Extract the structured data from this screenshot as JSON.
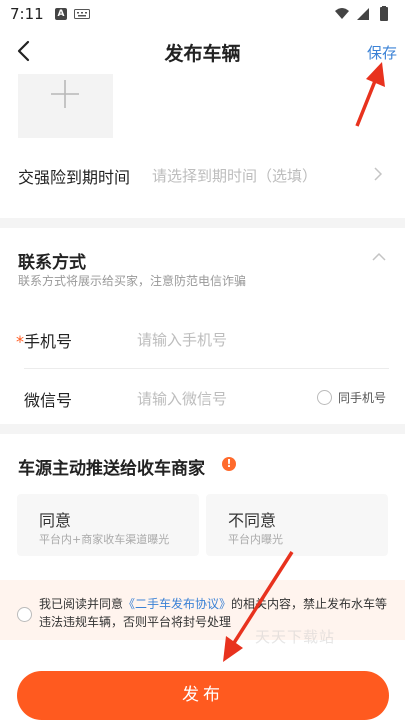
{
  "status_bar": {
    "time": "7:11",
    "notif_icon": "A"
  },
  "nav": {
    "title": "发布车辆",
    "save_label": "保存"
  },
  "insurance": {
    "label": "交强险到期时间",
    "placeholder": "请选择到期时间（选填）"
  },
  "contact": {
    "title": "联系方式",
    "subtitle": "联系方式将展示给买家，注意防范电信诈骗",
    "phone_required_mark": "*",
    "phone_label": "手机号",
    "phone_placeholder": "请输入手机号",
    "wechat_label": "微信号",
    "wechat_placeholder": "请输入微信号",
    "same_as_phone_label": "同手机号"
  },
  "push": {
    "title": "车源主动推送给收车商家",
    "info_icon_glyph": "!",
    "options": [
      {
        "title": "同意",
        "desc": "平台内+商家收车渠道曝光"
      },
      {
        "title": "不同意",
        "desc": "平台内曝光"
      }
    ]
  },
  "agreement": {
    "text_before": "我已阅读并同意",
    "link": "《二手车发布协议》",
    "text_after": "的相关内容，禁止发布水车等违法违规车辆，否则平台将封号处理"
  },
  "watermark": "天天下载站",
  "publish_label": "发布",
  "colors": {
    "accent": "#ff5a1f",
    "link": "#3b82d6",
    "annotation_arrow": "#e8321e"
  }
}
